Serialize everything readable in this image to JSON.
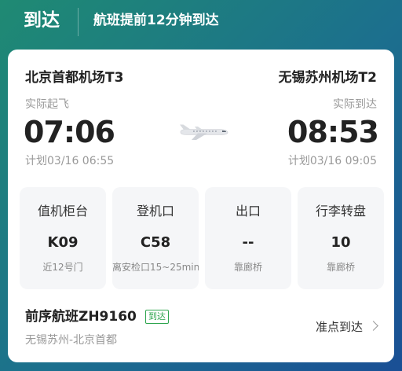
{
  "header": {
    "status": "到达",
    "detail": "航班提前12分钟到达"
  },
  "flight": {
    "departure": {
      "airport": "北京首都机场T3",
      "time_label": "实际起飞",
      "time": "07:06",
      "planned": "计划03/16 06:55"
    },
    "arrival": {
      "airport": "无锡苏州机场T2",
      "time_label": "实际到达",
      "time": "08:53",
      "planned": "计划03/16 09:05"
    },
    "plane_icon": "airplane-icon"
  },
  "info": [
    {
      "title": "值机柜台",
      "value": "K09",
      "sub": "近12号门"
    },
    {
      "title": "登机口",
      "value": "C58",
      "sub": "离安检口15~25min"
    },
    {
      "title": "出口",
      "value": "--",
      "sub": "靠廊桥"
    },
    {
      "title": "行李转盘",
      "value": "10",
      "sub": "靠廊桥"
    }
  ],
  "previous_flight": {
    "title": "前序航班ZH9160",
    "badge": "到达",
    "route": "无锡苏州-北京首都",
    "status": "准点到达"
  },
  "colors": {
    "badge": "#2ea54e",
    "header_gradient_start": "#1f8a73",
    "header_gradient_end": "#1a4f95"
  }
}
